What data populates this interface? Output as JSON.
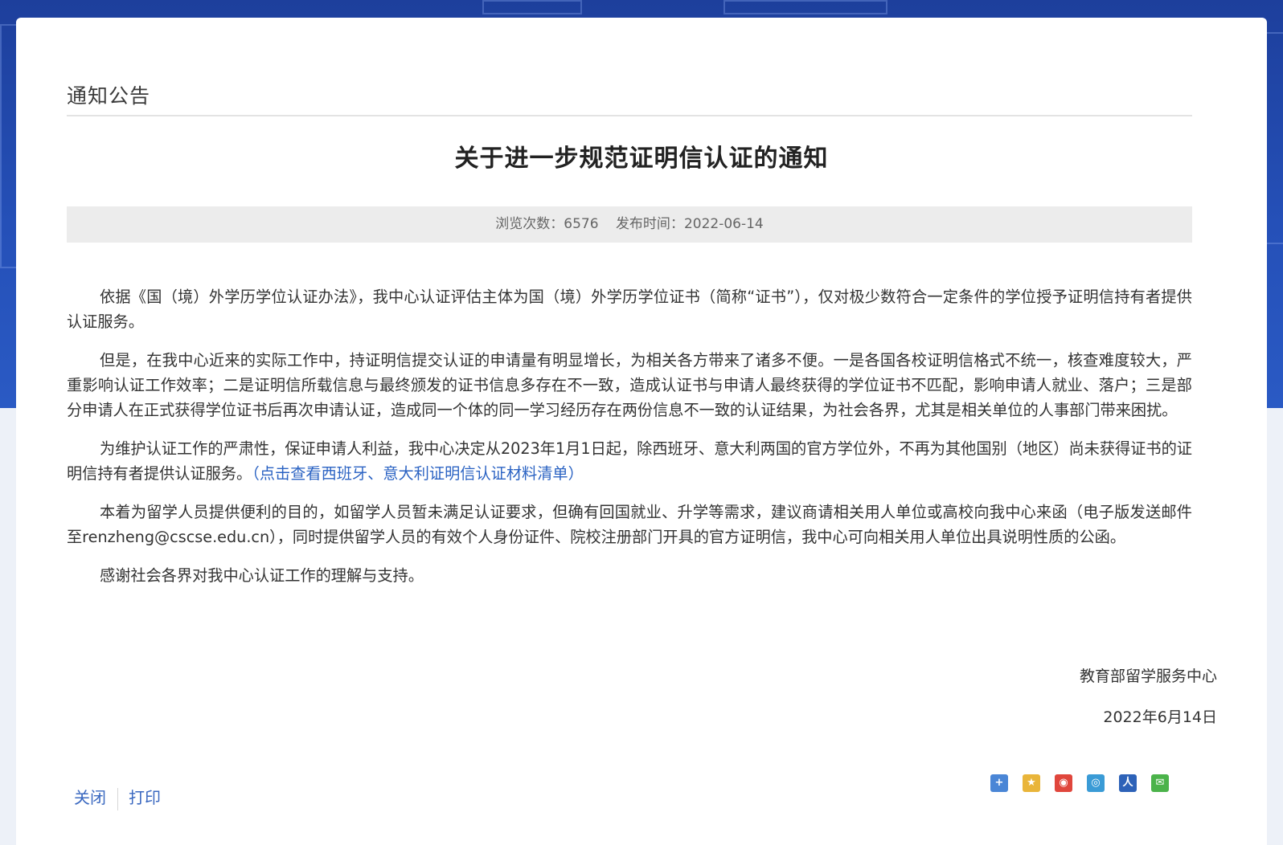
{
  "page": {
    "section_title": "通知公告",
    "article_title": "关于进一步规范证明信认证的通知",
    "meta": {
      "views_label": "浏览次数：",
      "views": "6576",
      "date_label": "发布时间：",
      "date": "2022-06-14"
    }
  },
  "content": {
    "p1": "依据《国（境）外学历学位认证办法》，我中心认证评估主体为国（境）外学历学位证书（简称“证书”），仅对极少数符合一定条件的学位授予证明信持有者提供认证服务。",
    "p2": "但是，在我中心近来的实际工作中，持证明信提交认证的申请量有明显增长，为相关各方带来了诸多不便。一是各国各校证明信格式不统一，核查难度较大，严重影响认证工作效率；二是证明信所载信息与最终颁发的证书信息多存在不一致，造成认证书与申请人最终获得的学位证书不匹配，影响申请人就业、落户；三是部分申请人在正式获得学位证书后再次申请认证，造成同一个体的同一学习经历存在两份信息不一致的认证结果，为社会各界，尤其是相关单位的人事部门带来困扰。",
    "p3": "为维护认证工作的严肃性，保证申请人利益，我中心决定从2023年1月1日起，除西班牙、意大利两国的官方学位外，不再为其他国别（地区）尚未获得证书的证明信持有者提供认证服务。",
    "p3_link": "（点击查看西班牙、意大利证明信认证材料清单）",
    "p4": "本着为留学人员提供便利的目的，如留学人员暂未满足认证要求，但确有回国就业、升学等需求，建议商请相关用人单位或高校向我中心来函（电子版发送邮件至renzheng@cscse.edu.cn），同时提供留学人员的有效个人身份证件、院校注册部门开具的官方证明信，我中心可向相关用人单位出具说明性质的公函。",
    "p5": "感谢社会各界对我中心认证工作的理解与支持。",
    "signature_org": "教育部留学服务中心",
    "signature_date": "2022年6月14日"
  },
  "actions": {
    "close_label": "关闭",
    "print_label": "打印"
  },
  "share": {
    "icons": [
      {
        "name": "plus-icon",
        "glyph": "+",
        "color": "#4a86d6"
      },
      {
        "name": "qzone-icon",
        "glyph": "★",
        "color": "#e9b53a"
      },
      {
        "name": "weibo-icon",
        "glyph": "◉",
        "color": "#e0463c"
      },
      {
        "name": "tencent-weibo-icon",
        "glyph": "◎",
        "color": "#3a9bd6"
      },
      {
        "name": "renren-icon",
        "glyph": "人",
        "color": "#2d62b8"
      },
      {
        "name": "wechat-icon",
        "glyph": "✉",
        "color": "#4bb34a"
      }
    ]
  }
}
